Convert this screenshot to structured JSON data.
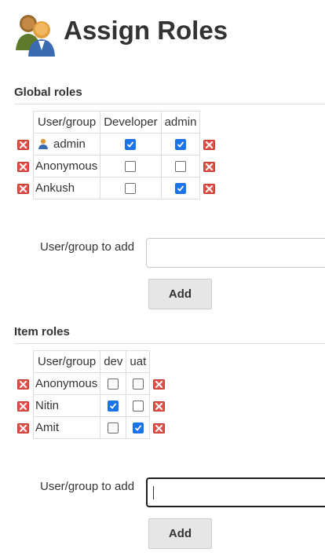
{
  "page": {
    "title": "Assign Roles",
    "logo_icon": "users-icon"
  },
  "global": {
    "title": "Global roles",
    "header_user": "User/group",
    "roles": [
      "Developer",
      "admin"
    ],
    "rows": [
      {
        "name": "admin",
        "has_user_icon": true,
        "checks": [
          true,
          true
        ]
      },
      {
        "name": "Anonymous",
        "has_user_icon": false,
        "checks": [
          false,
          false
        ]
      },
      {
        "name": "Ankush",
        "has_user_icon": false,
        "checks": [
          false,
          true
        ]
      }
    ],
    "add_label": "User/group to add",
    "add_value": "",
    "add_button": "Add"
  },
  "item": {
    "title": "Item roles",
    "header_user": "User/group",
    "roles": [
      "dev",
      "uat"
    ],
    "rows": [
      {
        "name": "Anonymous",
        "has_user_icon": false,
        "checks": [
          false,
          false
        ]
      },
      {
        "name": "Nitin",
        "has_user_icon": false,
        "checks": [
          true,
          false
        ]
      },
      {
        "name": "Amit",
        "has_user_icon": false,
        "checks": [
          false,
          true
        ]
      }
    ],
    "add_label": "User/group to add",
    "add_value": "",
    "add_button": "Add"
  },
  "colors": {
    "checkbox_checked": "#1a73e8",
    "delete_icon": "#e05048",
    "border": "#dddddd"
  }
}
